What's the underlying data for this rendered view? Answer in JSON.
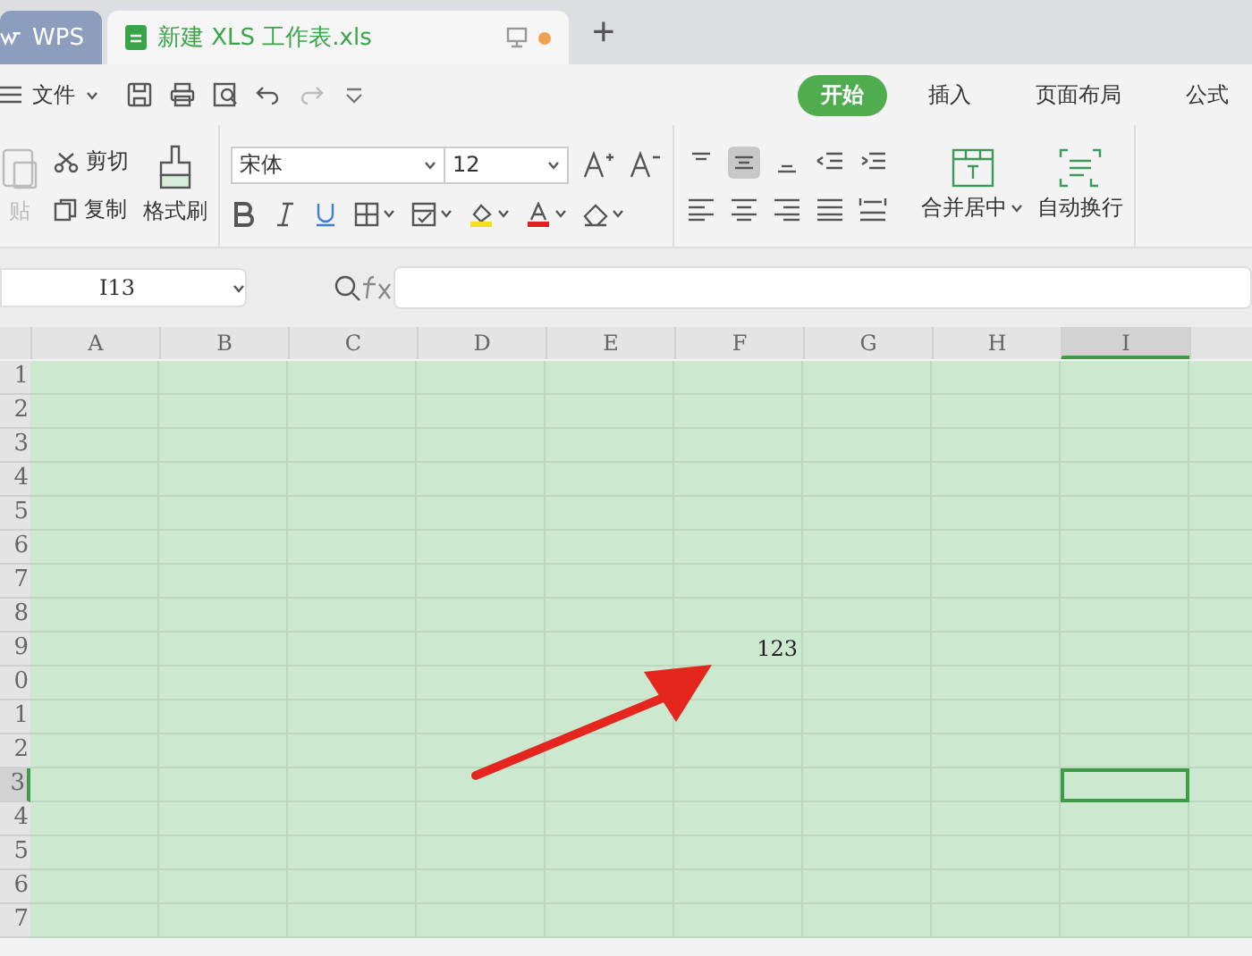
{
  "tabs": [
    {
      "kind": "app",
      "label": "WPS",
      "selected": false
    },
    {
      "kind": "doc",
      "label": "新建 XLS 工作表.xls",
      "selected": true,
      "modified": true
    }
  ],
  "new_tab": "+",
  "menu": {
    "file": "文件",
    "ribbon_tabs": [
      {
        "label": "开始",
        "selected": true
      },
      {
        "label": "插入",
        "selected": false
      },
      {
        "label": "页面布局",
        "selected": false
      },
      {
        "label": "公式",
        "selected": false
      }
    ]
  },
  "ribbon": {
    "paste": {
      "label": "贴",
      "disabled": true
    },
    "cut": "剪切",
    "copy": "复制",
    "format_painter": "格式刷",
    "font": "宋体",
    "font_size": "12",
    "merge": "合并居中",
    "wrap": "自动换行"
  },
  "formula_bar": {
    "cell_ref": "I13"
  },
  "sheet": {
    "columns": [
      {
        "label": "A",
        "selected": false
      },
      {
        "label": "B",
        "selected": false
      },
      {
        "label": "C",
        "selected": false
      },
      {
        "label": "D",
        "selected": false
      },
      {
        "label": "E",
        "selected": false
      },
      {
        "label": "F",
        "selected": false
      },
      {
        "label": "G",
        "selected": false
      },
      {
        "label": "H",
        "selected": false
      },
      {
        "label": "I",
        "selected": true
      }
    ],
    "rows": [
      {
        "label": "1",
        "selected": false
      },
      {
        "label": "2",
        "selected": false
      },
      {
        "label": "3",
        "selected": false
      },
      {
        "label": "4",
        "selected": false
      },
      {
        "label": "5",
        "selected": false
      },
      {
        "label": "6",
        "selected": false
      },
      {
        "label": "7",
        "selected": false
      },
      {
        "label": "8",
        "selected": false
      },
      {
        "label": "9",
        "selected": false,
        "cells": [
          null,
          null,
          null,
          null,
          null,
          "123"
        ]
      },
      {
        "label": "0",
        "selected": false
      },
      {
        "label": "1",
        "selected": false
      },
      {
        "label": "2",
        "selected": false
      },
      {
        "label": "3",
        "selected": true
      },
      {
        "label": "4",
        "selected": false
      },
      {
        "label": "5",
        "selected": false
      },
      {
        "label": "6",
        "selected": false
      },
      {
        "label": "7",
        "selected": false
      }
    ]
  }
}
